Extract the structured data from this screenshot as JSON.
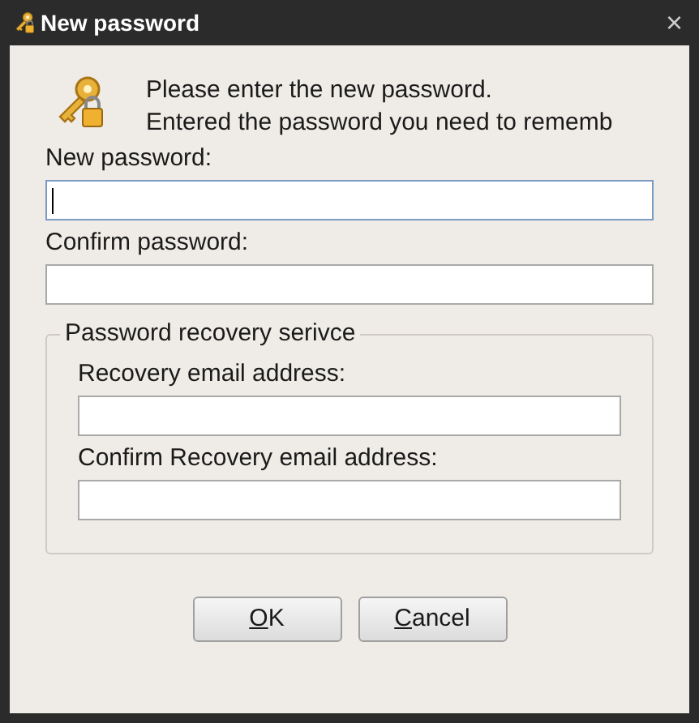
{
  "window": {
    "title": "New password",
    "close": "×"
  },
  "message": [
    "Please enter the new password.",
    "Entered the password you need to rememb"
  ],
  "fields": [
    {
      "label": "New password:",
      "focused": true
    },
    {
      "label": "Confirm password:",
      "focused": false
    }
  ],
  "recovery": {
    "title": "Password recovery serivce",
    "fields": [
      {
        "label": "Recovery email address:",
        "focused": false
      },
      {
        "label": "Confirm Recovery email address:",
        "focused": false
      }
    ]
  },
  "buttons": [
    "OK",
    "Cancel"
  ]
}
